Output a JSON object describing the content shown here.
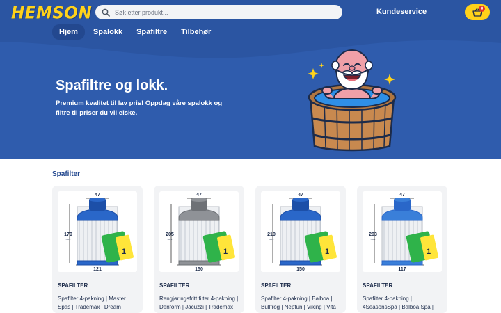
{
  "brand": {
    "logo": "HEMSON"
  },
  "search": {
    "placeholder": "Søk etter produkt..."
  },
  "header": {
    "customer_service": "Kundeservice",
    "cart_count": "0"
  },
  "nav": {
    "items": [
      "Hjem",
      "Spalokk",
      "Spafiltre",
      "Tilbehør"
    ]
  },
  "hero": {
    "title": "Spafiltre og lokk.",
    "text": "Premium kvalitet til lav pris! Oppdag våre spalokk og filtre til priser du vil elske."
  },
  "section": {
    "title": "Spafilter"
  },
  "products": [
    {
      "category": "SPAFILTER",
      "name": "Spafilter 4-pakning | Master Spas | Trademax | Dream",
      "dim_top": "47",
      "dim_side": "179",
      "dim_bottom": "121",
      "unit": "mm",
      "color": "#2a67c9",
      "cap": "#1c4fa8"
    },
    {
      "category": "SPAFILTER",
      "name": "Rengjøringsfritt filter 4-pakning | Denform | Jacuzzi | Trademax",
      "dim_top": "47",
      "dim_side": "205",
      "dim_bottom": "150",
      "unit": "mm",
      "color": "#8f9297",
      "cap": "#6e7176"
    },
    {
      "category": "SPAFILTER",
      "name": "Spafilter 4-pakning | Balboa | Bullfrog | Neptun | Viking | Vita",
      "dim_top": "47",
      "dim_side": "210",
      "dim_bottom": "150",
      "unit": "mm",
      "color": "#2a67c9",
      "cap": "#1c4fa8"
    },
    {
      "category": "SPAFILTER",
      "name": "Spafilter 4-pakning | 4SeasonsSpa | Balboa Spa |",
      "dim_top": "47",
      "dim_side": "203",
      "dim_bottom": "117",
      "unit": "mm",
      "color": "#3a7fd9",
      "cap": "#2a67c9"
    }
  ],
  "colors": {
    "primary": "#2f5cad",
    "accent": "#ffd21a",
    "dark_blue": "#23488f"
  }
}
